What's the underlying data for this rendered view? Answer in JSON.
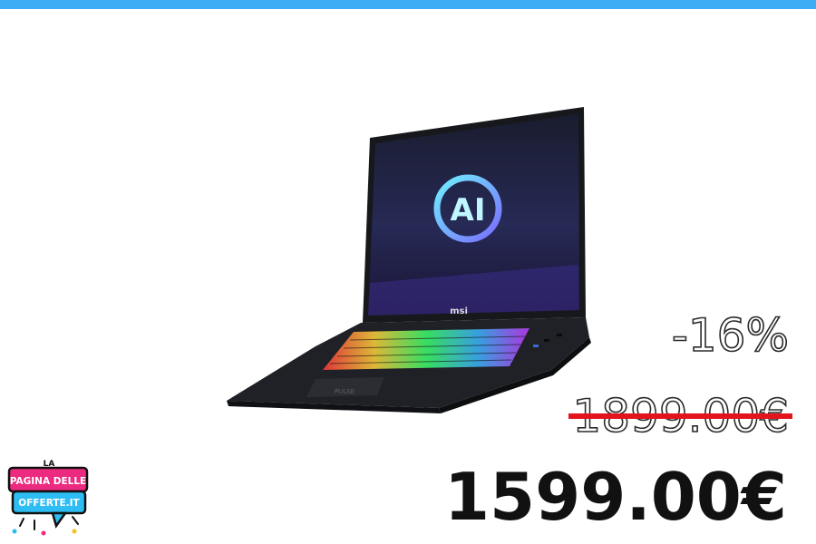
{
  "product": {
    "screen_logo": "AI",
    "brand": "msi",
    "deck_name": "PULSE"
  },
  "pricing": {
    "discount": "-16%",
    "old_price": "1899.00€",
    "new_price": "1599.00€"
  },
  "logo": {
    "line1": "LA",
    "line2": "PAGINA DELLE",
    "line3": "OFFERTE.IT"
  },
  "colors": {
    "accent": "#3daef5",
    "strike": "#e3141b",
    "price": "#111111"
  }
}
